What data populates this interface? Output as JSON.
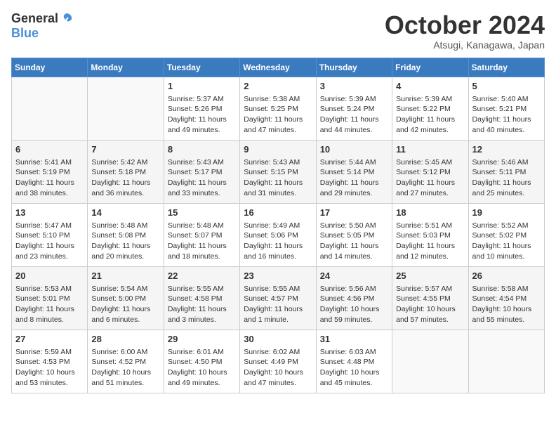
{
  "logo": {
    "general": "General",
    "blue": "Blue"
  },
  "title": "October 2024",
  "subtitle": "Atsugi, Kanagawa, Japan",
  "headers": [
    "Sunday",
    "Monday",
    "Tuesday",
    "Wednesday",
    "Thursday",
    "Friday",
    "Saturday"
  ],
  "weeks": [
    [
      {
        "day": "",
        "info": ""
      },
      {
        "day": "",
        "info": ""
      },
      {
        "day": "1",
        "info": "Sunrise: 5:37 AM\nSunset: 5:26 PM\nDaylight: 11 hours and 49 minutes."
      },
      {
        "day": "2",
        "info": "Sunrise: 5:38 AM\nSunset: 5:25 PM\nDaylight: 11 hours and 47 minutes."
      },
      {
        "day": "3",
        "info": "Sunrise: 5:39 AM\nSunset: 5:24 PM\nDaylight: 11 hours and 44 minutes."
      },
      {
        "day": "4",
        "info": "Sunrise: 5:39 AM\nSunset: 5:22 PM\nDaylight: 11 hours and 42 minutes."
      },
      {
        "day": "5",
        "info": "Sunrise: 5:40 AM\nSunset: 5:21 PM\nDaylight: 11 hours and 40 minutes."
      }
    ],
    [
      {
        "day": "6",
        "info": "Sunrise: 5:41 AM\nSunset: 5:19 PM\nDaylight: 11 hours and 38 minutes."
      },
      {
        "day": "7",
        "info": "Sunrise: 5:42 AM\nSunset: 5:18 PM\nDaylight: 11 hours and 36 minutes."
      },
      {
        "day": "8",
        "info": "Sunrise: 5:43 AM\nSunset: 5:17 PM\nDaylight: 11 hours and 33 minutes."
      },
      {
        "day": "9",
        "info": "Sunrise: 5:43 AM\nSunset: 5:15 PM\nDaylight: 11 hours and 31 minutes."
      },
      {
        "day": "10",
        "info": "Sunrise: 5:44 AM\nSunset: 5:14 PM\nDaylight: 11 hours and 29 minutes."
      },
      {
        "day": "11",
        "info": "Sunrise: 5:45 AM\nSunset: 5:12 PM\nDaylight: 11 hours and 27 minutes."
      },
      {
        "day": "12",
        "info": "Sunrise: 5:46 AM\nSunset: 5:11 PM\nDaylight: 11 hours and 25 minutes."
      }
    ],
    [
      {
        "day": "13",
        "info": "Sunrise: 5:47 AM\nSunset: 5:10 PM\nDaylight: 11 hours and 23 minutes."
      },
      {
        "day": "14",
        "info": "Sunrise: 5:48 AM\nSunset: 5:08 PM\nDaylight: 11 hours and 20 minutes."
      },
      {
        "day": "15",
        "info": "Sunrise: 5:48 AM\nSunset: 5:07 PM\nDaylight: 11 hours and 18 minutes."
      },
      {
        "day": "16",
        "info": "Sunrise: 5:49 AM\nSunset: 5:06 PM\nDaylight: 11 hours and 16 minutes."
      },
      {
        "day": "17",
        "info": "Sunrise: 5:50 AM\nSunset: 5:05 PM\nDaylight: 11 hours and 14 minutes."
      },
      {
        "day": "18",
        "info": "Sunrise: 5:51 AM\nSunset: 5:03 PM\nDaylight: 11 hours and 12 minutes."
      },
      {
        "day": "19",
        "info": "Sunrise: 5:52 AM\nSunset: 5:02 PM\nDaylight: 11 hours and 10 minutes."
      }
    ],
    [
      {
        "day": "20",
        "info": "Sunrise: 5:53 AM\nSunset: 5:01 PM\nDaylight: 11 hours and 8 minutes."
      },
      {
        "day": "21",
        "info": "Sunrise: 5:54 AM\nSunset: 5:00 PM\nDaylight: 11 hours and 6 minutes."
      },
      {
        "day": "22",
        "info": "Sunrise: 5:55 AM\nSunset: 4:58 PM\nDaylight: 11 hours and 3 minutes."
      },
      {
        "day": "23",
        "info": "Sunrise: 5:55 AM\nSunset: 4:57 PM\nDaylight: 11 hours and 1 minute."
      },
      {
        "day": "24",
        "info": "Sunrise: 5:56 AM\nSunset: 4:56 PM\nDaylight: 10 hours and 59 minutes."
      },
      {
        "day": "25",
        "info": "Sunrise: 5:57 AM\nSunset: 4:55 PM\nDaylight: 10 hours and 57 minutes."
      },
      {
        "day": "26",
        "info": "Sunrise: 5:58 AM\nSunset: 4:54 PM\nDaylight: 10 hours and 55 minutes."
      }
    ],
    [
      {
        "day": "27",
        "info": "Sunrise: 5:59 AM\nSunset: 4:53 PM\nDaylight: 10 hours and 53 minutes."
      },
      {
        "day": "28",
        "info": "Sunrise: 6:00 AM\nSunset: 4:52 PM\nDaylight: 10 hours and 51 minutes."
      },
      {
        "day": "29",
        "info": "Sunrise: 6:01 AM\nSunset: 4:50 PM\nDaylight: 10 hours and 49 minutes."
      },
      {
        "day": "30",
        "info": "Sunrise: 6:02 AM\nSunset: 4:49 PM\nDaylight: 10 hours and 47 minutes."
      },
      {
        "day": "31",
        "info": "Sunrise: 6:03 AM\nSunset: 4:48 PM\nDaylight: 10 hours and 45 minutes."
      },
      {
        "day": "",
        "info": ""
      },
      {
        "day": "",
        "info": ""
      }
    ]
  ]
}
